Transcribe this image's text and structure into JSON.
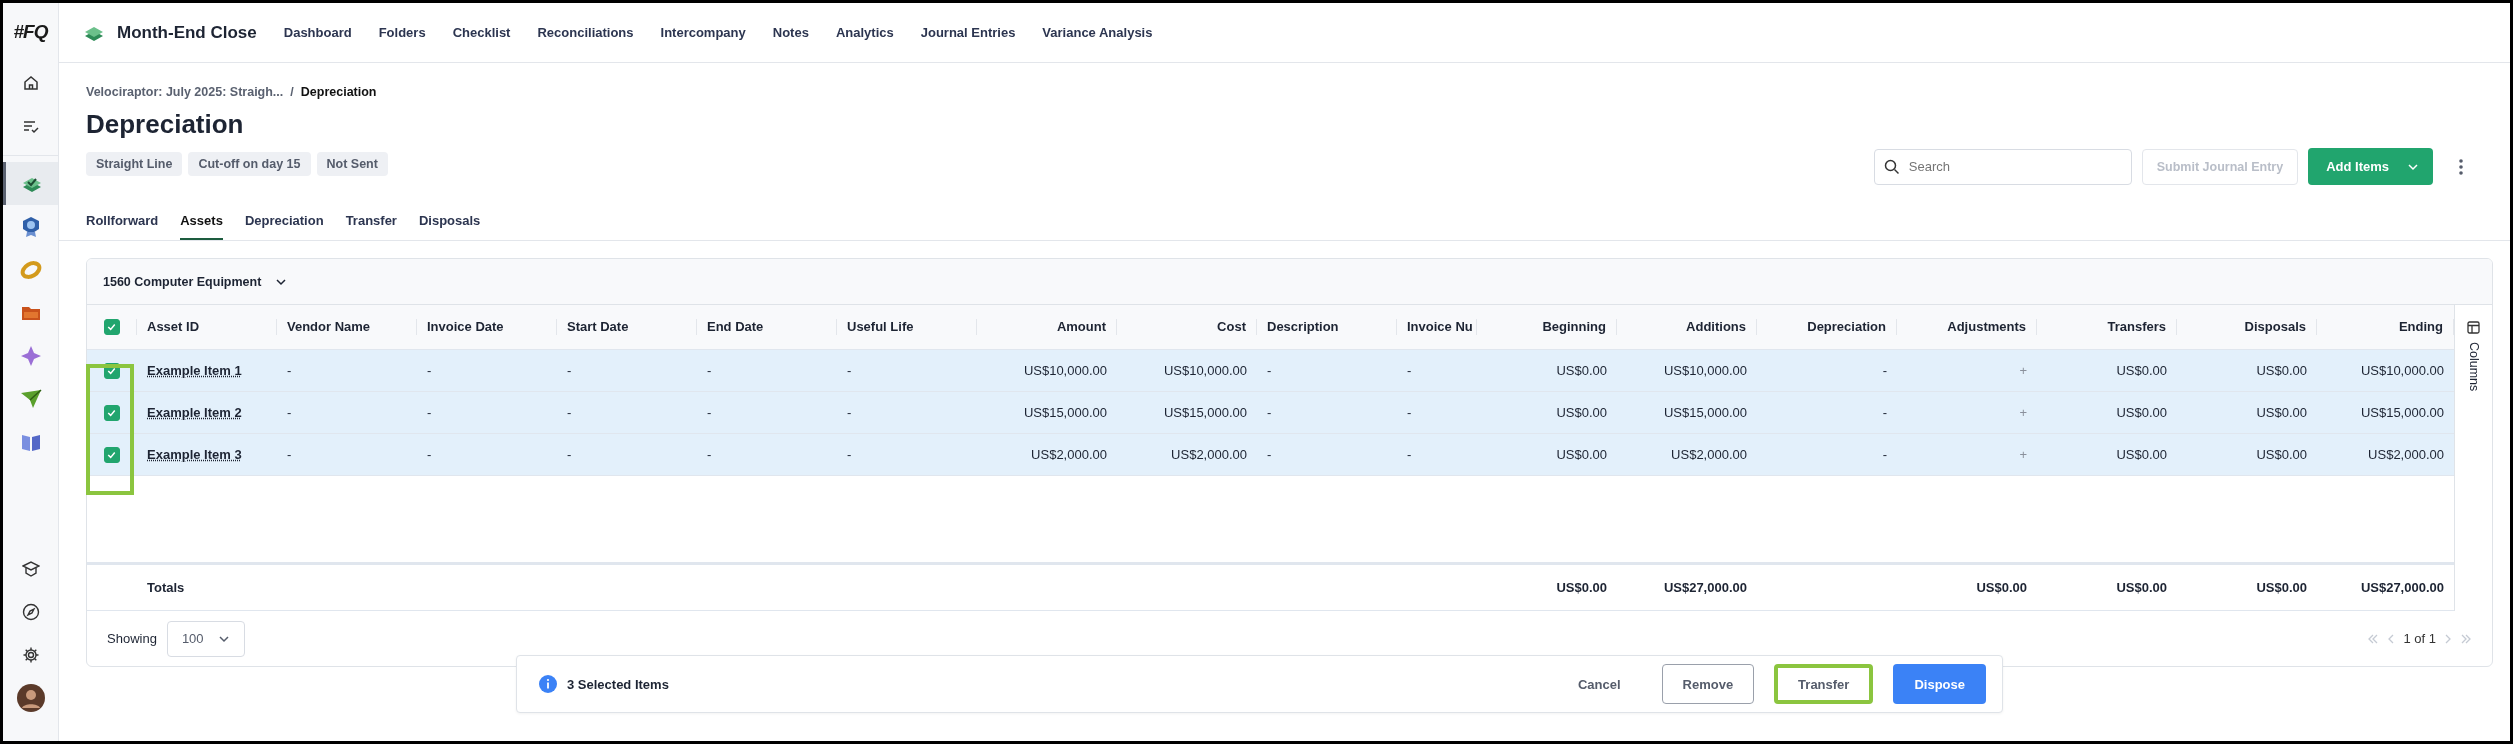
{
  "logo": "#FQ",
  "app_title": "Month-End Close",
  "nav": [
    "Dashboard",
    "Folders",
    "Checklist",
    "Reconciliations",
    "Intercompany",
    "Notes",
    "Analytics",
    "Journal Entries",
    "Variance Analysis"
  ],
  "sidebar": {
    "top": [
      {
        "kind": "home"
      },
      {
        "kind": "tasks"
      }
    ],
    "apps": [
      {
        "kind": "stack",
        "selected": true
      },
      {
        "kind": "badge",
        "selected": false
      },
      {
        "kind": "ring",
        "selected": false
      },
      {
        "kind": "folder",
        "selected": false
      },
      {
        "kind": "sparkle",
        "selected": false
      },
      {
        "kind": "plane",
        "selected": false
      },
      {
        "kind": "book",
        "selected": false
      }
    ],
    "bottom": [
      {
        "kind": "cap"
      },
      {
        "kind": "compass"
      },
      {
        "kind": "gear"
      },
      {
        "kind": "avatar"
      }
    ]
  },
  "breadcrumb": [
    "Velociraptor: July 2025: Straigh...",
    "Depreciation"
  ],
  "breadcrumb_separator": "/",
  "title": "Depreciation",
  "tags": [
    "Straight Line",
    "Cut-off on day 15",
    "Not Sent"
  ],
  "tabs": [
    {
      "label": "Rollforward",
      "selected": false
    },
    {
      "label": "Assets",
      "selected": true
    },
    {
      "label": "Depreciation",
      "selected": false
    },
    {
      "label": "Transfer",
      "selected": false
    },
    {
      "label": "Disposals",
      "selected": false
    }
  ],
  "search": {
    "placeholder": "Search"
  },
  "submit_button": {
    "label": "Submit Journal Entry",
    "disabled": true
  },
  "add_button": {
    "label": "Add Items"
  },
  "table": {
    "group": "1560 Computer Equipment",
    "all_selected": true,
    "checkbox_column_highlighted": true,
    "columns_panel": "Columns",
    "totals_label": "Totals",
    "columns": [
      {
        "label": "Asset ID",
        "kind": "text"
      },
      {
        "label": "Vendor Name",
        "kind": "text"
      },
      {
        "label": "Invoice Date",
        "kind": "text"
      },
      {
        "label": "Start Date",
        "kind": "text"
      },
      {
        "label": "End Date",
        "kind": "text"
      },
      {
        "label": "Useful Life",
        "kind": "text"
      },
      {
        "label": "Amount",
        "kind": "amount"
      },
      {
        "label": "Cost",
        "kind": "amount"
      },
      {
        "label": "Description",
        "kind": "text"
      },
      {
        "label": "Invoice Nu",
        "kind": "text"
      },
      {
        "label": "Beginning",
        "kind": "amount",
        "total": "US$0.00"
      },
      {
        "label": "Additions",
        "kind": "amount",
        "total": "US$27,000.00"
      },
      {
        "label": "Depreciation",
        "kind": "amount"
      },
      {
        "label": "Adjustments",
        "kind": "amount",
        "total": "US$0.00"
      },
      {
        "label": "Transfers",
        "kind": "amount",
        "total": "US$0.00"
      },
      {
        "label": "Disposals",
        "kind": "amount",
        "total": "US$0.00"
      },
      {
        "label": "Ending",
        "kind": "amount",
        "total": "US$27,000.00"
      }
    ],
    "rows": [
      {
        "selected": true,
        "cells": [
          "Example Item 1",
          "-",
          "-",
          "-",
          "-",
          "-",
          "US$10,000.00",
          "US$10,000.00",
          "-",
          "-",
          "US$0.00",
          "US$10,000.00",
          "-",
          "+",
          "US$0.00",
          "US$0.00",
          "US$10,000.00"
        ]
      },
      {
        "selected": true,
        "cells": [
          "Example Item 2",
          "-",
          "-",
          "-",
          "-",
          "-",
          "US$15,000.00",
          "US$15,000.00",
          "-",
          "-",
          "US$0.00",
          "US$15,000.00",
          "-",
          "+",
          "US$0.00",
          "US$0.00",
          "US$15,000.00"
        ]
      },
      {
        "selected": true,
        "cells": [
          "Example Item 3",
          "-",
          "-",
          "-",
          "-",
          "-",
          "US$2,000.00",
          "US$2,000.00",
          "-",
          "-",
          "US$0.00",
          "US$2,000.00",
          "-",
          "+",
          "US$0.00",
          "US$0.00",
          "US$2,000.00"
        ]
      }
    ]
  },
  "footer": {
    "showing_label": "Showing",
    "page_size": "100",
    "pagination": "1 of 1"
  },
  "action_bar": {
    "count": "3 Selected Items",
    "buttons": [
      {
        "label": "Cancel",
        "kind": "text",
        "highlighted": false
      },
      {
        "label": "Remove",
        "kind": "outline",
        "highlighted": false
      },
      {
        "label": "Transfer",
        "kind": "outline",
        "highlighted": true
      },
      {
        "label": "Dispose",
        "kind": "primary",
        "highlighted": false
      }
    ]
  }
}
